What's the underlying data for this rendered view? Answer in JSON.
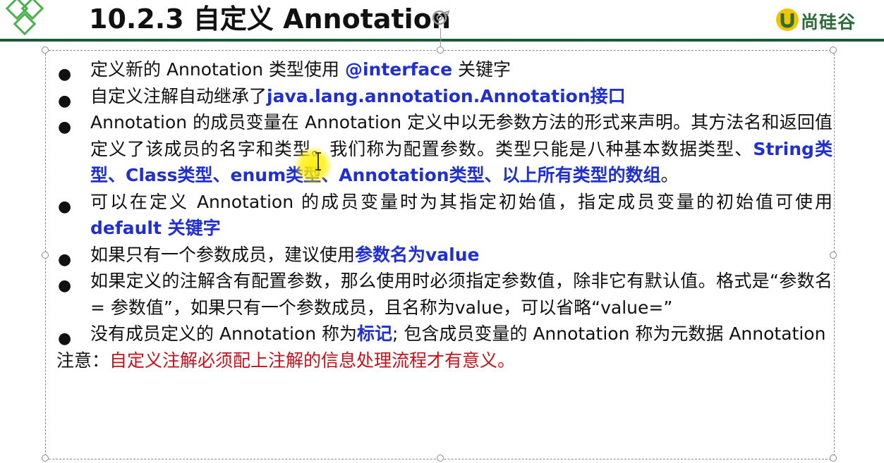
{
  "header": {
    "title": "10.2.3 自定义 Annotation",
    "brand": "尚硅谷",
    "icons": [
      "diamonds-logo-icon",
      "rotate-icon",
      "brand-u-icon"
    ],
    "colors": {
      "rule": "#1f5a36",
      "brand": "#2e6b3a"
    }
  },
  "colors": {
    "keyword_blue": "#1f2fd0",
    "note_red": "#c8101a"
  },
  "content": {
    "items": [
      {
        "t1": "定义新的 Annotation 类型使用 ",
        "k1": "@interface",
        "t2": " 关键字"
      },
      {
        "t1": "自定义注解自动继承了",
        "k1": "java.lang.annotation.Annotation接口"
      },
      {
        "t1": "Annotation 的成员变量在 Annotation 定义中以无参数方法的形式来声明。其方法名和返回值定义了该成员的名字和类型。我们称为配置参数。类型只能是八种基本数据类型、",
        "k1": "String类型、Class类型、enum类型、Annotation类型、以上所有类型的数组",
        "t2": "。"
      },
      {
        "t1": "可以在定义 Annotation 的成员变量时为其指定初始值，指定成员变量的初始值可使用 ",
        "k1": "default 关键字"
      },
      {
        "t1": "如果只有一个参数成员，建议使用",
        "k1": "参数名为value"
      },
      {
        "t1": "如果定义的注解含有配置参数，那么使用时必须指定参数值，除非它有默认值。格式是“参数名 = 参数值”，如果只有一个参数成员，且名称为value，可以省略“value=”"
      },
      {
        "t1": "没有成员定义的 Annotation 称为",
        "k1": "标记",
        "t2": "; 包含成员变量的 Annotation 称为元数据 Annotation"
      }
    ],
    "note_label": "注意：",
    "note_text": "自定义注解必须配上注解的信息处理流程才有意义。"
  }
}
